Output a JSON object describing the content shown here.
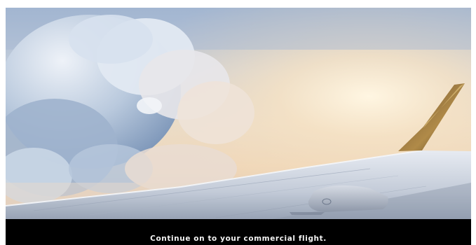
{
  "caption": {
    "text": "Continue on to your commercial flight."
  },
  "scene": {
    "icon": "airplane-wing-above-clouds",
    "colors": {
      "sky_top": "#9fb4cf",
      "sun_glow": "#fff3dc",
      "cloud": "#dfe8f2",
      "cloud_shadow": "#8fa7c4",
      "wing": "#cfd6e2",
      "wing_shadow": "#8e99ab",
      "winglet": "#8a6a36",
      "caption_bar": "#000000",
      "caption_text": "#f2f2f2"
    }
  }
}
